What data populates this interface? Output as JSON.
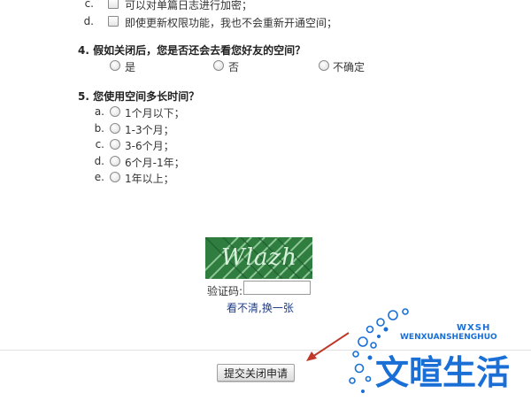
{
  "q3": {
    "options": [
      {
        "letter": "c.",
        "text": "可以对单篇日志进行加密；"
      },
      {
        "letter": "d.",
        "text": "即使更新权限功能，我也不会重新开通空间；"
      }
    ]
  },
  "q4": {
    "title": "4.  假如关闭后，您是否还会去看您好友的空间？",
    "options": [
      "是",
      "否",
      "不确定"
    ]
  },
  "q5": {
    "title": "5.  您使用空间多长时间？",
    "options": [
      {
        "letter": "a.",
        "text": "1个月以下；"
      },
      {
        "letter": "b.",
        "text": "1-3个月；"
      },
      {
        "letter": "c.",
        "text": "3-6个月；"
      },
      {
        "letter": "d.",
        "text": "6个月-1年；"
      },
      {
        "letter": "e.",
        "text": "1年以上；"
      }
    ]
  },
  "captcha": {
    "image_text": "Wlazh",
    "label": "验证码:",
    "value": "",
    "refresh_link": "看不清,换一张"
  },
  "submit_label": "提交关闭申请",
  "watermark": {
    "pinyin": "WENXUANSHENGHUO",
    "tag": "WXSH",
    "brand": "文暄生活"
  },
  "colors": {
    "captcha_bg": "#2f7d3f",
    "link": "#1f3c88",
    "watermark_blue": "#1a6fd6",
    "arrow": "#c0392b"
  }
}
